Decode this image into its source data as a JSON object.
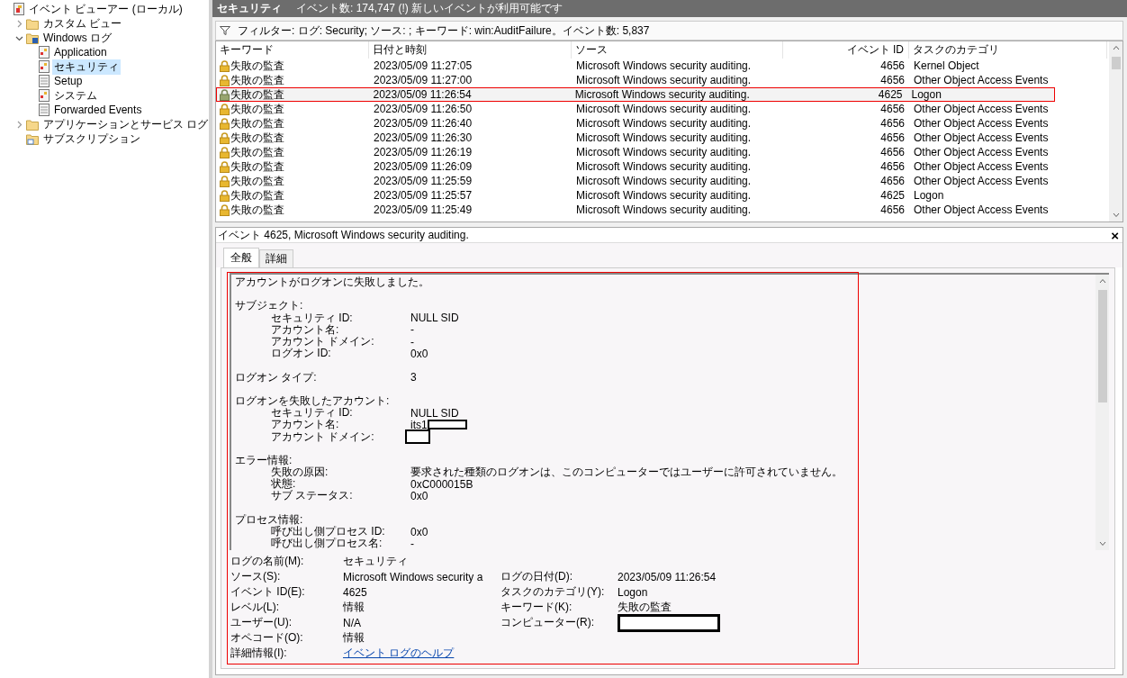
{
  "tree": [
    {
      "label": "イベント ビューアー (ローカル)",
      "kind": "viewer",
      "selected": false,
      "children": [
        {
          "label": "カスタム ビュー",
          "kind": "folder",
          "expanded": false,
          "selected": false
        },
        {
          "label": "Windows ログ",
          "kind": "logfolder",
          "expanded": true,
          "selected": false,
          "children": [
            {
              "label": "Application",
              "kind": "log",
              "selected": false
            },
            {
              "label": "セキュリティ",
              "kind": "log",
              "selected": true
            },
            {
              "label": "Setup",
              "kind": "document",
              "selected": false
            },
            {
              "label": "システム",
              "kind": "log",
              "selected": false
            },
            {
              "label": "Forwarded Events",
              "kind": "document",
              "selected": false
            }
          ]
        },
        {
          "label": "アプリケーションとサービス ログ",
          "kind": "folder",
          "expanded": false,
          "selected": false
        },
        {
          "label": "サブスクリプション",
          "kind": "subscription",
          "selected": false
        }
      ]
    }
  ],
  "header": {
    "title": "セキュリティ",
    "info": "イベント数: 174,747 (!) 新しいイベントが利用可能です"
  },
  "filter": "フィルター: ログ: Security; ソース: ; キーワード: win:AuditFailure。イベント数: 5,837",
  "table": {
    "columns": [
      "キーワード",
      "日付と時刻",
      "ソース",
      "イベント ID",
      "タスクのカテゴリ"
    ],
    "rows": [
      {
        "keyword": "失敗の監査",
        "date": "2023/05/09 11:27:05",
        "source": "Microsoft Windows security auditing.",
        "id": "4656",
        "category": "Kernel Object",
        "selected": false
      },
      {
        "keyword": "失敗の監査",
        "date": "2023/05/09 11:27:00",
        "source": "Microsoft Windows security auditing.",
        "id": "4656",
        "category": "Other Object Access Events",
        "selected": false
      },
      {
        "keyword": "失敗の監査",
        "date": "2023/05/09 11:26:54",
        "source": "Microsoft Windows security auditing.",
        "id": "4625",
        "category": "Logon",
        "selected": true
      },
      {
        "keyword": "失敗の監査",
        "date": "2023/05/09 11:26:50",
        "source": "Microsoft Windows security auditing.",
        "id": "4656",
        "category": "Other Object Access Events",
        "selected": false
      },
      {
        "keyword": "失敗の監査",
        "date": "2023/05/09 11:26:40",
        "source": "Microsoft Windows security auditing.",
        "id": "4656",
        "category": "Other Object Access Events",
        "selected": false
      },
      {
        "keyword": "失敗の監査",
        "date": "2023/05/09 11:26:30",
        "source": "Microsoft Windows security auditing.",
        "id": "4656",
        "category": "Other Object Access Events",
        "selected": false
      },
      {
        "keyword": "失敗の監査",
        "date": "2023/05/09 11:26:19",
        "source": "Microsoft Windows security auditing.",
        "id": "4656",
        "category": "Other Object Access Events",
        "selected": false
      },
      {
        "keyword": "失敗の監査",
        "date": "2023/05/09 11:26:09",
        "source": "Microsoft Windows security auditing.",
        "id": "4656",
        "category": "Other Object Access Events",
        "selected": false
      },
      {
        "keyword": "失敗の監査",
        "date": "2023/05/09 11:25:59",
        "source": "Microsoft Windows security auditing.",
        "id": "4656",
        "category": "Other Object Access Events",
        "selected": false
      },
      {
        "keyword": "失敗の監査",
        "date": "2023/05/09 11:25:57",
        "source": "Microsoft Windows security auditing.",
        "id": "4625",
        "category": "Logon",
        "selected": false
      },
      {
        "keyword": "失敗の監査",
        "date": "2023/05/09 11:25:49",
        "source": "Microsoft Windows security auditing.",
        "id": "4656",
        "category": "Other Object Access Events",
        "selected": false
      }
    ]
  },
  "detail": {
    "title": "イベント 4625, Microsoft Windows security auditing.",
    "close": "×",
    "tabs": [
      {
        "label": "全般",
        "selected": true
      },
      {
        "label": "詳細",
        "selected": false
      }
    ],
    "message": "アカウントがログオンに失敗しました。",
    "sections": [
      {
        "title": "サブジェクト:",
        "fields": [
          {
            "label": "セキュリティ ID:",
            "value": "NULL SID"
          },
          {
            "label": "アカウント名:",
            "value": "-"
          },
          {
            "label": "アカウント ドメイン:",
            "value": "-"
          },
          {
            "label": "ログオン ID:",
            "value": "0x0"
          }
        ]
      },
      {
        "title": "ログオン タイプ:",
        "value": "3"
      },
      {
        "title": "ログオンを失敗したアカウント:",
        "fields": [
          {
            "label": "セキュリティ ID:",
            "value": "NULL SID"
          },
          {
            "label": "アカウント名:",
            "value": "its1",
            "redacted": true
          },
          {
            "label": "アカウント ドメイン:",
            "redacted": true
          }
        ]
      },
      {
        "title": "エラー情報:",
        "fields": [
          {
            "label": "失敗の原因:",
            "value": "要求された種類のログオンは、このコンピューターではユーザーに許可されていません。"
          },
          {
            "label": "状態:",
            "value": "0xC000015B"
          },
          {
            "label": "サブ ステータス:",
            "value": "0x0"
          }
        ]
      },
      {
        "title": "プロセス情報:",
        "fields": [
          {
            "label": "呼び出し側プロセス ID:",
            "value": "0x0"
          },
          {
            "label": "呼び出し側プロセス名:",
            "value": "-"
          }
        ]
      }
    ],
    "properties": [
      [
        {
          "label": "ログの名前(M):",
          "value": "セキュリティ"
        }
      ],
      [
        {
          "label": "ソース(S):",
          "value": "Microsoft Windows security a"
        },
        {
          "label": "ログの日付(D):",
          "value": "2023/05/09 11:26:54"
        }
      ],
      [
        {
          "label": "イベント ID(E):",
          "value": "4625"
        },
        {
          "label": "タスクのカテゴリ(Y):",
          "value": "Logon"
        }
      ],
      [
        {
          "label": "レベル(L):",
          "value": "情報"
        },
        {
          "label": "キーワード(K):",
          "value": "失敗の監査"
        }
      ],
      [
        {
          "label": "ユーザー(U):",
          "value": "N/A"
        },
        {
          "label": "コンピューター(R):",
          "redacted": true
        }
      ],
      [
        {
          "label": "オペコード(O):",
          "value": "情報"
        }
      ],
      [
        {
          "label": "詳細情報(I):",
          "value": "イベント ログのヘルプ",
          "kind": "link"
        }
      ]
    ]
  }
}
